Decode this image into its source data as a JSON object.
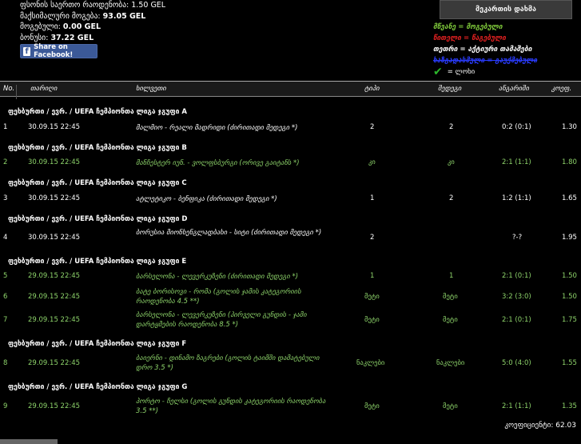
{
  "summary": {
    "total_stake_label": "ფსონის საერთო რაოდენობა:",
    "total_stake": "1.50 GEL",
    "max_win_label": "მაქსიმალური მოგება:",
    "max_win": "93.05 GEL",
    "won_label": "მოგებული:",
    "won": "0.00 GEL",
    "balance_label": "ბონუსი:",
    "balance": "37.22 GEL"
  },
  "facebook": {
    "label": "Share on Facebook!"
  },
  "matchmaker_button": "მეკართის დახმა",
  "legend": {
    "won": "მწვანე = მოგებული",
    "lost": "წითელი = წაგებული",
    "active": "თეთრი = აქტიური თამაშები",
    "cancelled": "ხაზგადასმული = გაუქმებული",
    "tick": "= ლოხი"
  },
  "columns": [
    "No.",
    "თარიღი",
    "ხილვეთი",
    "ტიპი",
    "შედეგი",
    "ანგარიში",
    "კოეფ."
  ],
  "groups": [
    {
      "title": "ფეხბურთი / ევრ. / UEFA ჩემპიონთა ლიგა ჯგუფი A",
      "rows": [
        {
          "no": "1",
          "date": "30.09.15 22:45",
          "event": "მალმიო - რეალი მადრიდი (ძირითადი მედეგი *)",
          "type": "2",
          "result": "2",
          "score": "0:2 (0:1)",
          "odds": "1.30",
          "color": "white"
        }
      ]
    },
    {
      "title": "ფეხბურთი / ევრ. / UEFA ჩემპიონთა ლიგა ჯგუფი B",
      "rows": [
        {
          "no": "2",
          "date": "30.09.15 22:45",
          "event": "მანჩესტერ იუნ. - ვოლფსბურგი (ორივე გაიტანს *)",
          "type": "კი",
          "result": "კი",
          "score": "2:1 (1:1)",
          "odds": "1.80",
          "color": "green"
        }
      ]
    },
    {
      "title": "ფეხბურთი / ევრ. / UEFA ჩემპიონთა ლიგა ჯგუფი C",
      "rows": [
        {
          "no": "3",
          "date": "30.09.15 22:45",
          "event": "ატლეტიკო - ბენფიკა (ძირითადი მედეგი *)",
          "type": "1",
          "result": "2",
          "score": "1:2 (1:1)",
          "odds": "1.65",
          "color": "white"
        }
      ]
    },
    {
      "title": "ფეხბურთი / ევრ. / UEFA ჩემპიონთა ლიგა ჯგუფი D",
      "rows": [
        {
          "no": "4",
          "date": "30.09.15 22:45",
          "event": "ბორუსია მიონხენგლადბახი - სიტი (ძირითადი მედეგი *)",
          "type": "2",
          "result": "",
          "score": "?-?",
          "odds": "1.95",
          "color": "white"
        }
      ]
    },
    {
      "title": "ფეხბურთი / ევრ. / UEFA ჩემპიონთა ლიგა ჯგუფი E",
      "rows": [
        {
          "no": "5",
          "date": "29.09.15 22:45",
          "event": "ბარსელონა - ლევერკუზენი (ძირითადი მედეგი *)",
          "type": "1",
          "result": "1",
          "score": "2:1 (0:1)",
          "odds": "1.50",
          "color": "green"
        },
        {
          "no": "6",
          "date": "29.09.15 22:45",
          "event": "ბატე ბორისოვი - რომა (გოლის ჯამის კატეგორიის რაოდენობა 4.5 **)",
          "type": "მეტი",
          "result": "მეტი",
          "score": "3:2 (3:0)",
          "odds": "1.50",
          "color": "green"
        },
        {
          "no": "7",
          "date": "29.09.15 22:45",
          "event": "ბარსელონა - ლევერკუზენი (პირველი გუნდის - ჯამი დარტყმების რაოდენობა 8.5 *)",
          "type": "მეტი",
          "result": "მეტი",
          "score": "2:1 (0:1)",
          "odds": "1.75",
          "color": "green"
        }
      ]
    },
    {
      "title": "ფეხბურთი / ევრ. / UEFA ჩემპიონთა ლიგა ჯგუფი F",
      "rows": [
        {
          "no": "8",
          "date": "29.09.15 22:45",
          "event": "ბაიერნი - დინამო ზაგრები (გოლის ტაიმში დამატებული დრო 3.5 *)",
          "type": "ნაკლები",
          "result": "ნაკლები",
          "score": "5:0 (4:0)",
          "odds": "1.55",
          "color": "green"
        }
      ]
    },
    {
      "title": "ფეხბურთი / ევრ. / UEFA ჩემპიონთა ლიგა ჯგუფი G",
      "rows": [
        {
          "no": "9",
          "date": "29.09.15 22:45",
          "event": "პორტო - ჩელსი (გოლის გუნდის კატეგორიის რაოდენობა 3.5 **)",
          "type": "მეტი",
          "result": "მეტი",
          "score": "2:1 (1:1)",
          "odds": "1.35",
          "color": "green"
        }
      ]
    }
  ],
  "total": "კოეფიციენტი: 62.03"
}
